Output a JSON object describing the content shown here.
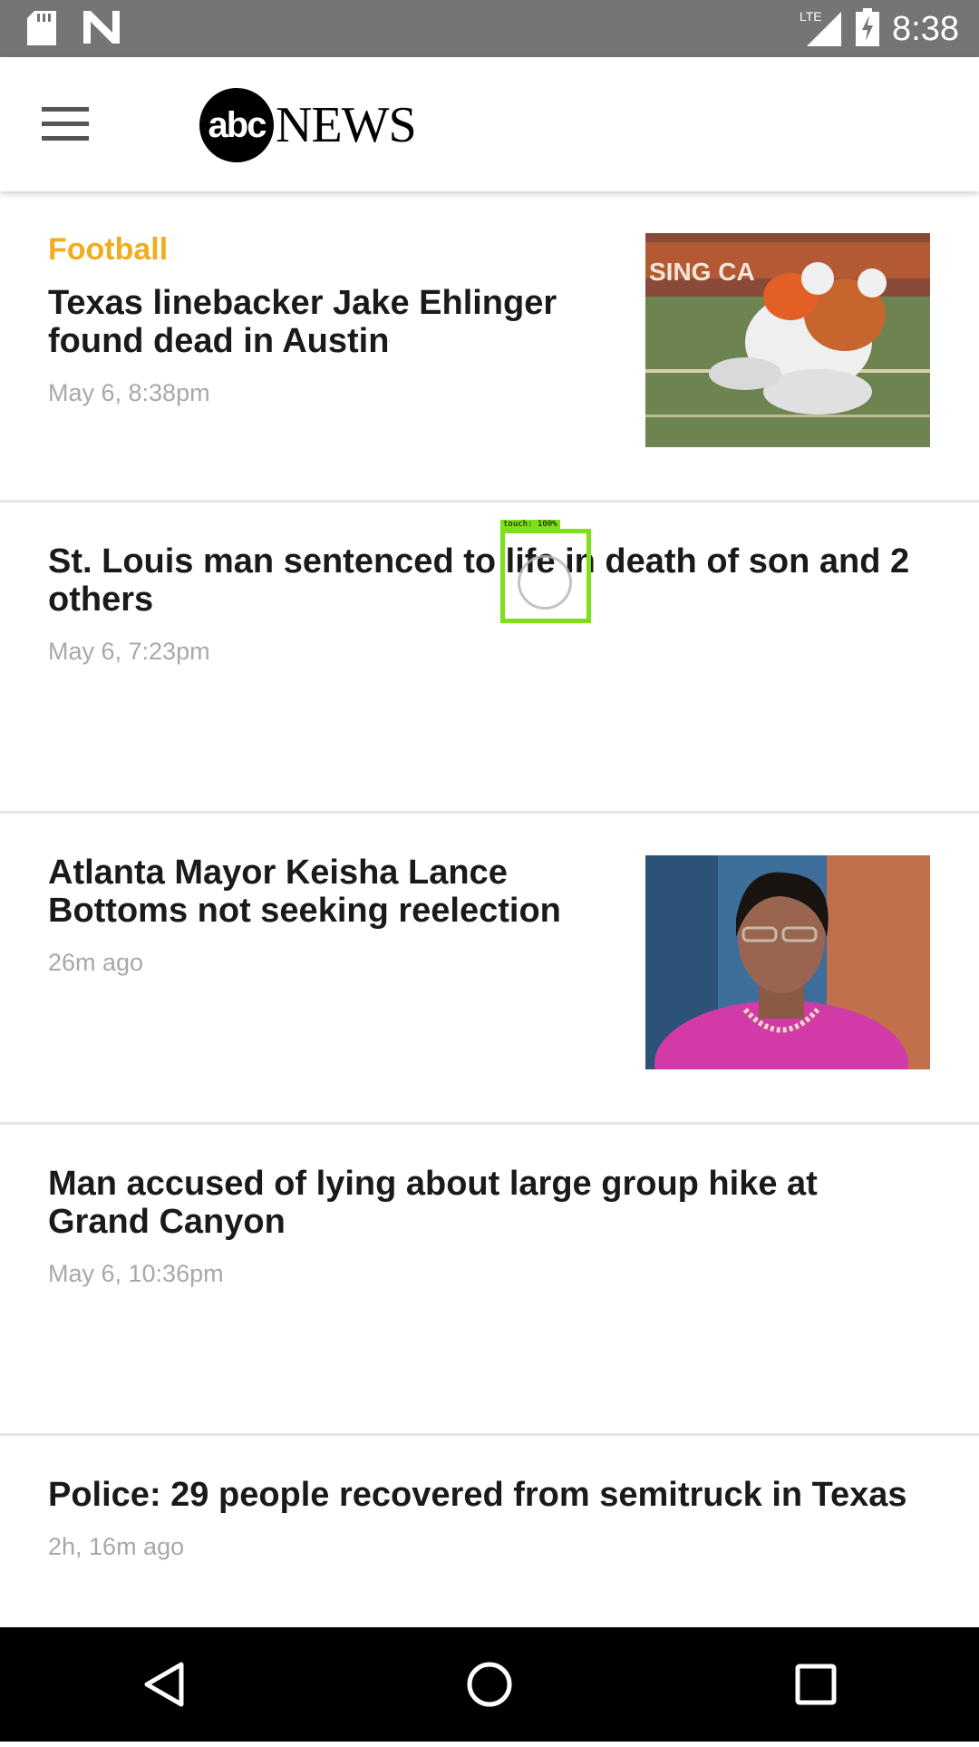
{
  "status_bar": {
    "time": "8:38",
    "network": "LTE",
    "icons": [
      "sd-card-icon",
      "n-icon",
      "signal-icon",
      "battery-charging-icon"
    ]
  },
  "header": {
    "logo_circle": "abc",
    "logo_word": "NEWS",
    "menu_icon": "hamburger-menu-icon"
  },
  "stories": [
    {
      "category": "Football",
      "headline": "Texas linebacker Jake Ehlinger found dead in Austin",
      "time": "May 6, 8:38pm",
      "has_image": true
    },
    {
      "category": "",
      "headline": "St. Louis man sentenced to life in death of son and 2 others",
      "time": "May 6, 7:23pm",
      "has_image": false
    },
    {
      "category": "",
      "headline": "Atlanta Mayor Keisha Lance Bottoms not seeking reelection",
      "time": "26m ago",
      "has_image": true
    },
    {
      "category": "",
      "headline": "Man accused of lying about large group hike at Grand Canyon",
      "time": "May 6, 10:36pm",
      "has_image": false
    },
    {
      "category": "",
      "headline": "Police: 29 people recovered from semitruck in Texas",
      "time": "2h, 16m ago",
      "has_image": false
    }
  ],
  "touch_overlay": {
    "label": "touch: 100%"
  },
  "nav_bar": {
    "buttons": [
      "back-icon",
      "home-icon",
      "recents-icon"
    ]
  },
  "colors": {
    "status_bar": "#757575",
    "category": "#f0ad1d",
    "headline": "#1a1a1a",
    "timestamp": "#a8a8a8",
    "touch_box": "#7ee01a"
  }
}
